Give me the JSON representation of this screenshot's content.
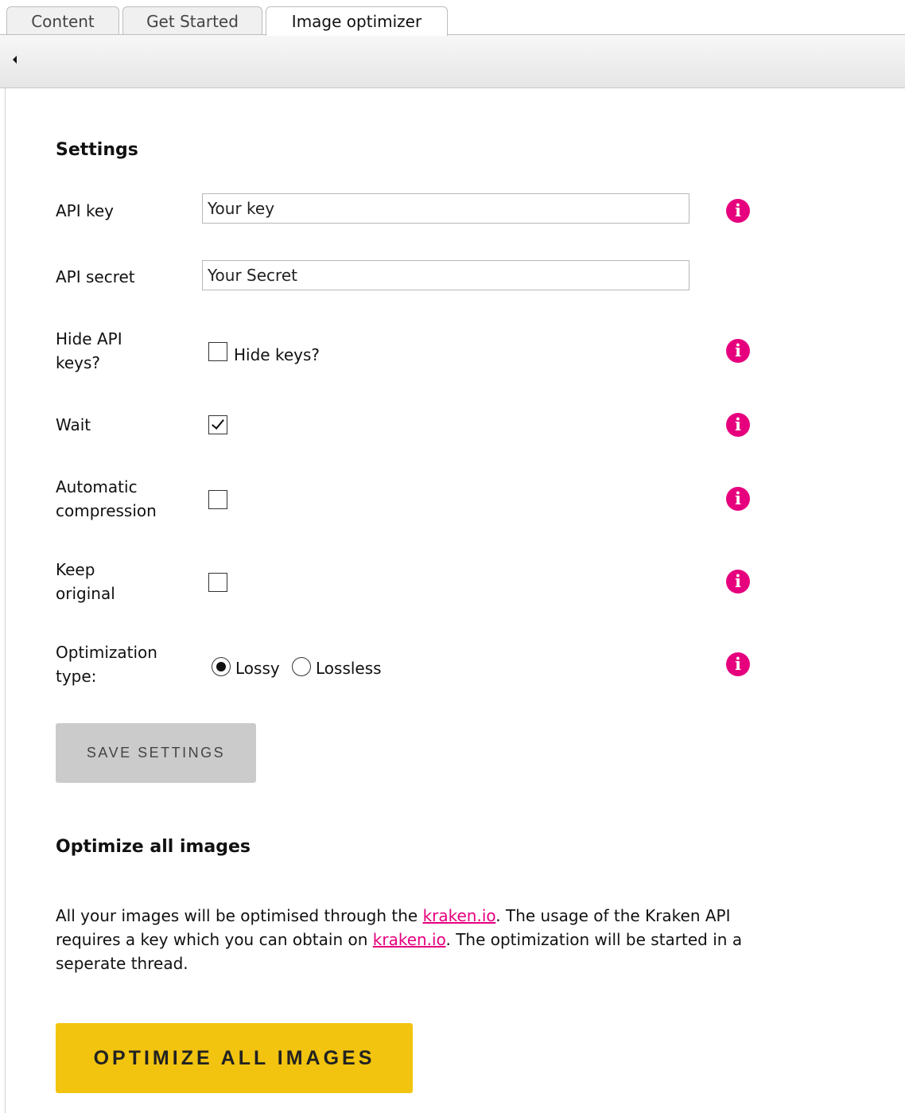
{
  "tabs": [
    {
      "label": "Content"
    },
    {
      "label": "Get Started"
    },
    {
      "label": "Image optimizer",
      "active": true
    }
  ],
  "settings": {
    "heading": "Settings",
    "api_key": {
      "label": "API key",
      "value": "Your key"
    },
    "api_secret": {
      "label": "API secret",
      "value": "Your Secret"
    },
    "hide_keys": {
      "label_line1": "Hide API",
      "label_line2": "keys?",
      "checkbox_text": "Hide keys?",
      "checked": false
    },
    "wait": {
      "label": "Wait",
      "checked": true
    },
    "auto_compression": {
      "label_line1": "Automatic",
      "label_line2": "compression",
      "checked": false
    },
    "keep_original": {
      "label_line1": "Keep",
      "label_line2": "original",
      "checked": false
    },
    "optimization_type": {
      "label_line1": "Optimization",
      "label_line2": "type:",
      "options": [
        {
          "label": "Lossy",
          "selected": true
        },
        {
          "label": "Lossless",
          "selected": false
        }
      ]
    },
    "info_icon_glyph": "i",
    "save_label": "SAVE SETTINGS"
  },
  "optimize": {
    "heading": "Optimize all images",
    "desc_part1": "All your images will be optimised through the ",
    "link1": "kraken.io",
    "desc_part2": ". The usage of the Kraken API requires a key which you can obtain on ",
    "link2": "kraken.io",
    "desc_part3": ". The optimization will be started in a seperate thread.",
    "button_label": "OPTIMIZE ALL IMAGES"
  },
  "colors": {
    "accent_pink": "#e6007e",
    "optimize_button": "#f2c40f",
    "save_button": "#cbcbcb"
  }
}
